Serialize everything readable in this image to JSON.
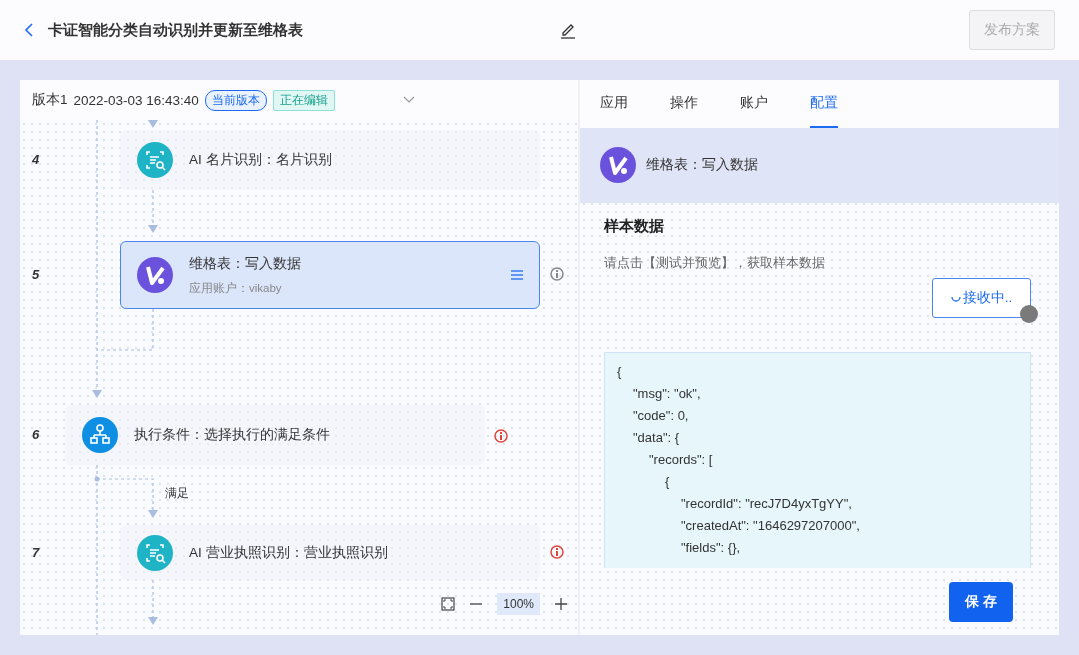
{
  "header": {
    "title": "卡证智能分类自动识别并更新至维格表",
    "publish_button": {
      "label": "发布方案",
      "disabled": true
    }
  },
  "version": {
    "label": "版本1",
    "timestamp": "2022-03-03 16:43:40",
    "badges": [
      {
        "text": "当前版本",
        "kind": "outline"
      },
      {
        "text": "正在编辑",
        "kind": "filled"
      }
    ]
  },
  "steps": [
    {
      "number": "4",
      "kind": "ai",
      "title": "AI 名片识别：名片识别",
      "selected": false
    },
    {
      "number": "5",
      "kind": "vika",
      "title": "维格表：写入数据",
      "subtitle": "应用账户：vikaby",
      "selected": true,
      "color": "#888888"
    },
    {
      "number": "6",
      "kind": "condition",
      "title": "执行条件：选择执行的满足条件",
      "selected": false,
      "color": "#e0453a"
    },
    {
      "number": "7",
      "kind": "ai",
      "title": "AI 营业执照识别：营业执照识别",
      "selected": false,
      "color": "#e0453a"
    }
  ],
  "branch_label": "满足",
  "zoom": {
    "value": "100%"
  },
  "tabs": [
    {
      "label": "应用",
      "selected": false
    },
    {
      "label": "操作",
      "selected": false
    },
    {
      "label": "账户",
      "selected": false
    },
    {
      "label": "配置",
      "selected": true
    }
  ],
  "config": {
    "app_title": "维格表：写入数据",
    "section_title": "样本数据",
    "hint": "请点击【测试并预览】，获取样本数据",
    "receive_button": {
      "label": "接收中..",
      "loading": true
    },
    "sample": [
      {
        "text": "{",
        "children": [
          {
            "text": "\"msg\": \"ok\","
          },
          {
            "text": "\"code\": 0,"
          },
          {
            "text": "\"data\": {",
            "children": [
              {
                "text": "\"records\": [",
                "children": [
                  {
                    "text": "{",
                    "children": [
                      {
                        "text": "\"recordId\": \"recJ7D4yxTgYY\","
                      },
                      {
                        "text": "\"createdAt\": \"1646297207000\","
                      },
                      {
                        "text": "\"fields\": {},"
                      }
                    ]
                  }
                ]
              }
            ]
          }
        ]
      }
    ]
  },
  "save_button": {
    "label": "保 存"
  }
}
